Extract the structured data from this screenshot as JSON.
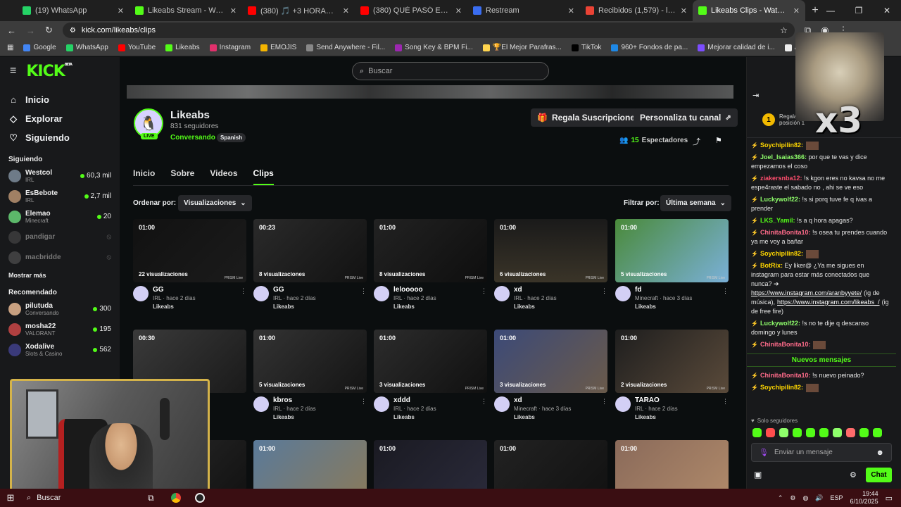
{
  "browser": {
    "tabs": [
      {
        "title": "(19) WhatsApp",
        "color": "#25d366"
      },
      {
        "title": "Likeabs Stream - Watch Live on",
        "color": "#53fc18"
      },
      {
        "title": "(380) 🎵 +3 HORAS DE REGGA",
        "color": "#ff0000"
      },
      {
        "title": "(380) QUÉ PASÓ EL SÁBADO? ",
        "color": "#ff0000"
      },
      {
        "title": "Restream",
        "color": "#3a6df0"
      },
      {
        "title": "Recibidos (1,579) - likeabsplay",
        "color": "#ea4335"
      },
      {
        "title": "Likeabs Clips - Watch Live on",
        "color": "#53fc18"
      }
    ],
    "url": "kick.com/likeabs/clips",
    "bookmarks": [
      {
        "label": "Google",
        "color": "#4285f4"
      },
      {
        "label": "WhatsApp",
        "color": "#25d366"
      },
      {
        "label": "YouTube",
        "color": "#ff0000"
      },
      {
        "label": "Likeabs",
        "color": "#53fc18"
      },
      {
        "label": "Instagram",
        "color": "#e1306c"
      },
      {
        "label": "EMOJIS",
        "color": "#f4b400"
      },
      {
        "label": "Send Anywhere - Fil...",
        "color": "#888888"
      },
      {
        "label": "Song Key & BPM Fi...",
        "color": "#9c27b0"
      },
      {
        "label": "🏆El Mejor Parafras...",
        "color": "#ffd54f"
      },
      {
        "label": "TikTok",
        "color": "#000000"
      },
      {
        "label": "960+ Fondos de pa...",
        "color": "#1e88e5"
      },
      {
        "label": "Mejorar calidad de i...",
        "color": "#7c4dff"
      },
      {
        "label": "Academia de redes...",
        "color": "#eeeeee"
      }
    ]
  },
  "kick": {
    "logo": "KICK",
    "beta": "BETA",
    "search_placeholder": "Buscar"
  },
  "sidebar": {
    "nav": [
      "Inicio",
      "Explorar",
      "Siguiendo"
    ],
    "following_title": "Siguiendo",
    "following": [
      {
        "name": "Westcol",
        "sub": "IRL",
        "viewers": "60,3 mil",
        "live": true,
        "color": "#6e7b88"
      },
      {
        "name": "EsBebote",
        "sub": "IRL",
        "viewers": "2,7 mil",
        "live": true,
        "color": "#a08064"
      },
      {
        "name": "Elemao",
        "sub": "Minecraft",
        "viewers": "20",
        "live": true,
        "color": "#5cb86a"
      },
      {
        "name": "pandigar",
        "sub": "",
        "viewers": "",
        "live": false,
        "color": "#555555"
      },
      {
        "name": "macbridde",
        "sub": "",
        "viewers": "",
        "live": false,
        "color": "#666666"
      }
    ],
    "show_more": "Mostrar más",
    "recommended_title": "Recomendado",
    "recommended": [
      {
        "name": "pilutuda",
        "sub": "Conversando",
        "viewers": "300",
        "color": "#c8a080"
      },
      {
        "name": "mosha22",
        "sub": "VALORANT",
        "viewers": "195",
        "color": "#b04040"
      },
      {
        "name": "Xodalive",
        "sub": "Slots & Casino",
        "viewers": "562",
        "color": "#3a3a7a"
      }
    ]
  },
  "channel": {
    "name": "Likeabs",
    "followers": "831 seguidores",
    "category": "Conversando",
    "language": "Spanish",
    "live_badge": "LIVE",
    "gift_button": "Regala Suscripciones",
    "customize_button": "Personaliza tu canal",
    "viewers_count": "15",
    "viewers_label": "Espectadores",
    "tabs": [
      "Inicio",
      "Sobre",
      "Videos",
      "Clips"
    ],
    "active_tab": "Clips",
    "sort_label": "Ordenar por:",
    "sort_value": "Visualizaciones",
    "filter_label": "Filtrar por:",
    "filter_value": "Última semana"
  },
  "clips": [
    {
      "duration": "01:00",
      "views": "22 visualizaciones",
      "title": "GG",
      "meta": "IRL · hace 2 días",
      "user": "Likeabs",
      "bg": "linear-gradient(135deg,#111,#1b1b1b)"
    },
    {
      "duration": "00:23",
      "views": "8 visualizaciones",
      "title": "GG",
      "meta": "IRL · hace 2 días",
      "user": "Likeabs",
      "bg": "linear-gradient(135deg,#2a2a2a,#121212)"
    },
    {
      "duration": "01:00",
      "views": "8 visualizaciones",
      "title": "lelooooo",
      "meta": "IRL · hace 2 días",
      "user": "Likeabs",
      "bg": "linear-gradient(135deg,#222,#0e0e0e)"
    },
    {
      "duration": "01:00",
      "views": "6 visualizaciones",
      "title": "xd",
      "meta": "IRL · hace 2 días",
      "user": "Likeabs",
      "bg": "linear-gradient(180deg,#1a1a1a,#3a3428)"
    },
    {
      "duration": "01:00",
      "views": "5 visualizaciones",
      "title": "fd",
      "meta": "Minecraft · hace 3 días",
      "user": "Likeabs",
      "bg": "linear-gradient(135deg,#4a8a3a,#7ab0d8)"
    },
    {
      "duration": "00:30",
      "views": "",
      "title": "",
      "meta": "",
      "user": "",
      "bg": "linear-gradient(135deg,#3a3a3a,#1a1a1a)"
    },
    {
      "duration": "01:00",
      "views": "5 visualizaciones",
      "title": "kbros",
      "meta": "IRL · hace 2 días",
      "user": "Likeabs",
      "bg": "linear-gradient(135deg,#333,#141414)"
    },
    {
      "duration": "01:00",
      "views": "3 visualizaciones",
      "title": "xddd",
      "meta": "IRL · hace 2 días",
      "user": "Likeabs",
      "bg": "linear-gradient(135deg,#2c2c2c,#101010)"
    },
    {
      "duration": "01:00",
      "views": "3 visualizaciones",
      "title": "xd",
      "meta": "Minecraft · hace 3 días",
      "user": "Likeabs",
      "bg": "linear-gradient(135deg,#3c4a78,#6a5a4a)"
    },
    {
      "duration": "01:00",
      "views": "2 visualizaciones",
      "title": "TARAO",
      "meta": "IRL · hace 2 días",
      "user": "Likeabs",
      "bg": "linear-gradient(135deg,#1e1e1e,#5a4a3a)"
    },
    {
      "duration": "",
      "views": "",
      "title": "",
      "meta": "",
      "user": "",
      "bg": "linear-gradient(135deg,#2a2a2a,#111)"
    },
    {
      "duration": "01:00",
      "views": "",
      "title": "",
      "meta": "",
      "user": "",
      "bg": "linear-gradient(135deg,#5a7a9a,#8a7a5a)"
    },
    {
      "duration": "01:00",
      "views": "",
      "title": "",
      "meta": "",
      "user": "",
      "bg": "linear-gradient(135deg,#1a1a22,#2a2a3a)"
    },
    {
      "duration": "01:00",
      "views": "",
      "title": "",
      "meta": "",
      "user": "",
      "bg": "linear-gradient(135deg,#222,#111)"
    },
    {
      "duration": "01:00",
      "views": "",
      "title": "",
      "meta": "",
      "user": "",
      "bg": "linear-gradient(135deg,#8a6a5a,#b08a6a)"
    }
  ],
  "prism_label": "PRISM Live",
  "chat": {
    "pinned_name": "Regala",
    "pinned_sub": "posición 1",
    "rank": "1",
    "messages": [
      {
        "user": "Soychipilin82:",
        "text": "",
        "color": "#ffd700"
      },
      {
        "user": "Joel_Isaias366:",
        "text": "por que te vas y dice empezamos el coso",
        "color": "#8fff6b"
      },
      {
        "user": "ziakersnba12:",
        "text": "!s kgon eres no kavsa no me espe4raste el sabado no , ahi se ve eso",
        "color": "#ff4d6d"
      },
      {
        "user": "Luckywolf22:",
        "text": "!s si porq tuve fe q ivas a prender",
        "color": "#8fff6b"
      },
      {
        "user": "LKS_Yamil:",
        "text": "!s a q hora apagas?",
        "color": "#53fc18"
      },
      {
        "user": "ChinitaBonita10:",
        "text": "!s osea tu prendes cuando ya me voy a bañar",
        "color": "#ff6b8a"
      },
      {
        "user": "Soychipilin82:",
        "text": "",
        "color": "#ffd700"
      },
      {
        "user": "BotRix:",
        "text": "Ey liker@ ¿Ya me sigues en instagram para estar más conectados que nunca? ➔",
        "color": "#ffd700"
      },
      {
        "user": "Luckywolf22:",
        "text": "!s no te dije q descanso domingo y lunes",
        "color": "#8fff6b"
      },
      {
        "user": "ChinitaBonita10:",
        "text": "",
        "color": "#ff6b8a"
      }
    ],
    "link1": "https://www.instagram.com/aranbyyete/",
    "link1_suffix": "(ig de música),",
    "link2": "https://www.instagram.com/likeabs_/",
    "link2_suffix": "(ig de free fire)",
    "new_messages": "Nuevos mensajes",
    "after": [
      {
        "user": "ChinitaBonita10:",
        "text": "!s nuevo peinado?",
        "color": "#ff6b8a"
      },
      {
        "user": "Soychipilin82:",
        "text": "",
        "color": "#ffd700"
      }
    ],
    "followers_only": "Solo seguidores",
    "input_placeholder": "Enviar un mensaje",
    "send_label": "Chat"
  },
  "overlay": {
    "x3": "x3"
  },
  "taskbar": {
    "search": "Buscar",
    "time": "19:44",
    "date": "6/10/2025",
    "lang": "ESP"
  }
}
